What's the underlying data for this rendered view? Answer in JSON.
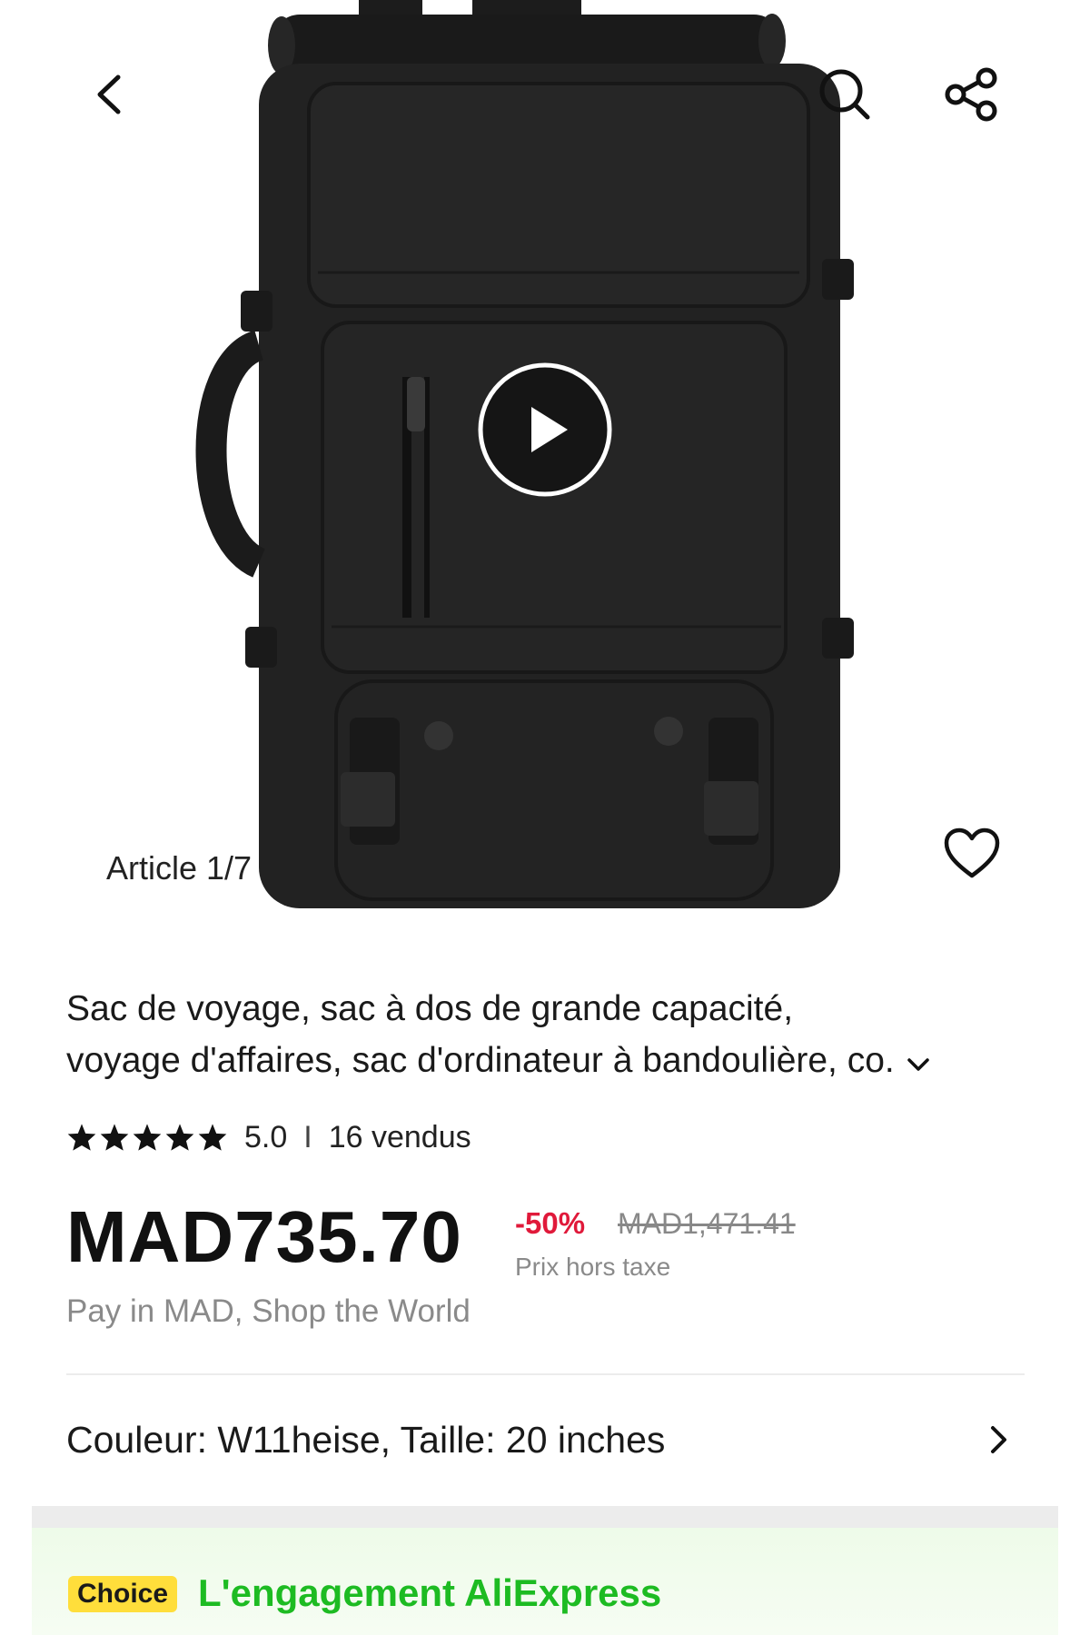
{
  "nav": {
    "back_icon": "chevron-left-icon",
    "search_icon": "search-icon",
    "share_icon": "share-icon"
  },
  "gallery": {
    "counter": "Article 1/7",
    "play_icon": "play-icon",
    "wishlist_icon": "heart-icon"
  },
  "product": {
    "title_line1": "Sac de voyage, sac à dos de grande capacité,",
    "title_line2": "voyage d'affaires, sac d'ordinateur à bandoulière, co.",
    "expand_icon": "chevron-down-icon",
    "rating": "5.0",
    "rating_separator": "I",
    "sold": "16 vendus",
    "stars": 5,
    "price": "MAD735.70",
    "discount": "-50%",
    "original_price": "MAD1,471.41",
    "tax_note": "Prix hors taxe",
    "pay_note": "Pay in MAD, Shop the World"
  },
  "variant": {
    "label": "Couleur: W11heise, Taille: 20 inches",
    "chevron_icon": "chevron-right-icon"
  },
  "choice": {
    "badge": "Choice",
    "title": "L'engagement AliExpress"
  },
  "colors": {
    "discount": "#e0193a",
    "choice_green": "#1dbb22",
    "choice_badge": "#ffde3b"
  }
}
